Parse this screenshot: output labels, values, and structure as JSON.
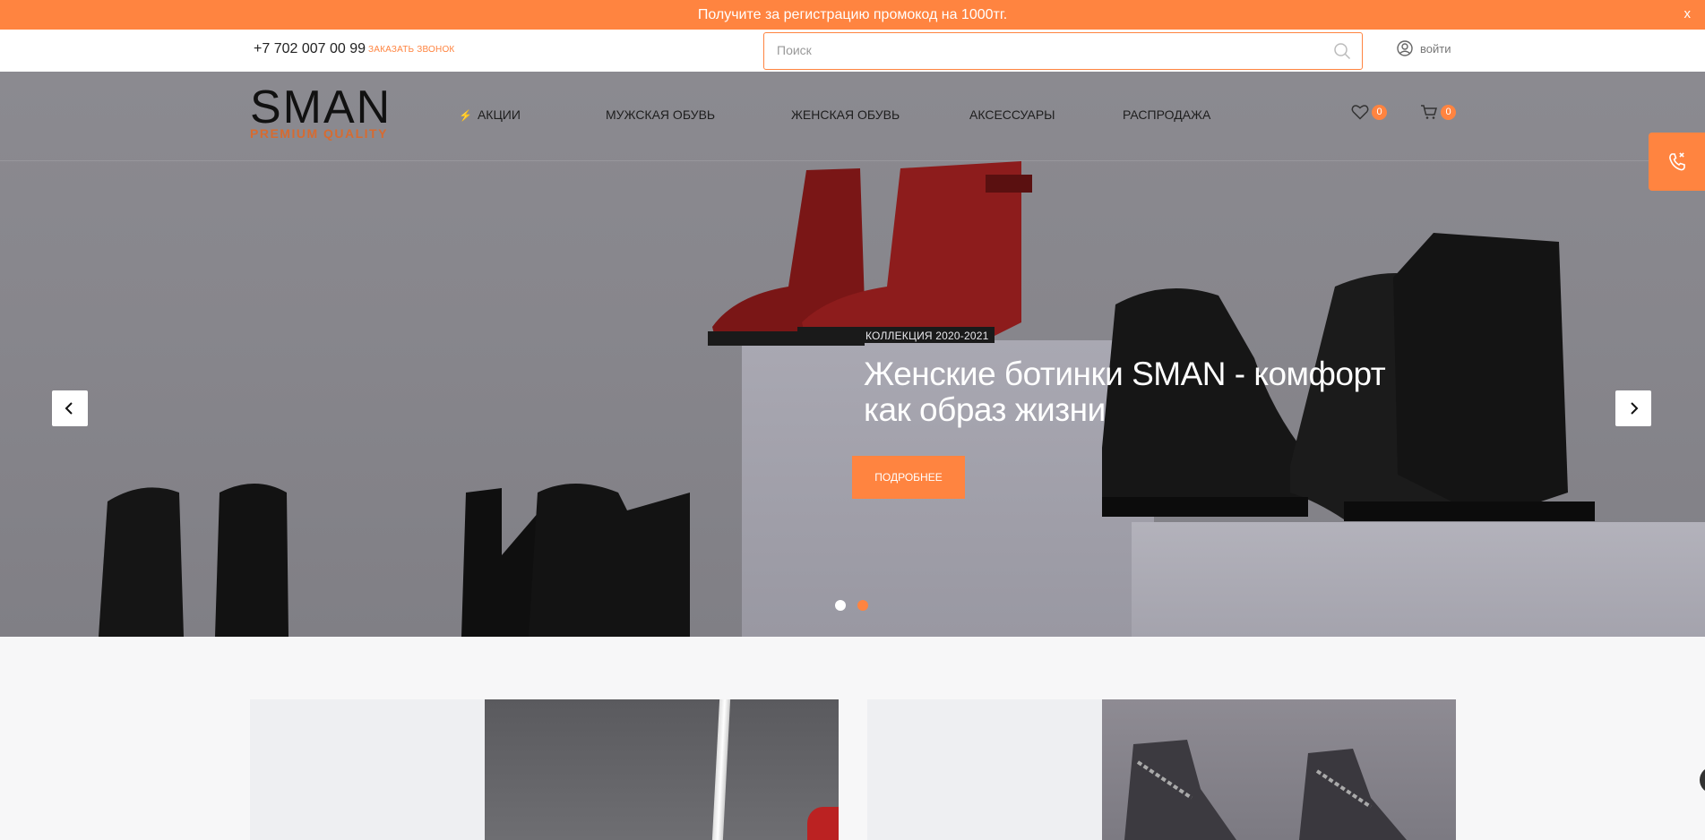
{
  "promo": {
    "text": "Получите за регистрацию промокод на 1000тг.",
    "close": "x"
  },
  "topbar": {
    "phone": "+7 702 007 00 99",
    "callback": "заказать звонок",
    "search_placeholder": "Поиск",
    "login": "войти"
  },
  "logo": {
    "name": "SMAN",
    "tagline": "PREMIUM QUALITY"
  },
  "nav": {
    "items": [
      "АКЦИИ",
      "МУЖСКАЯ ОБУВЬ",
      "ЖЕНСКАЯ ОБУВЬ",
      "АКСЕССУАРЫ",
      "РАСПРОДАЖА"
    ],
    "favorites_count": "0",
    "cart_count": "0"
  },
  "hero": {
    "label": "КОЛЛЕКЦИЯ 2020-2021",
    "title": "Женские ботинки SMAN - комфорт как образ жизни",
    "cta": "ПОДРОБНЕЕ",
    "slides": 2,
    "active_slide": 2
  },
  "colors": {
    "accent": "#ff8440",
    "hero_bg": "#87868c",
    "page_bg": "#f7f7f8"
  },
  "icons": {
    "bolt": "bolt-icon",
    "search": "search-icon",
    "user": "user-icon",
    "heart": "heart-icon",
    "cart": "cart-icon",
    "phone": "phone-icon",
    "prev": "chevron-left-icon",
    "next": "chevron-right-icon"
  }
}
